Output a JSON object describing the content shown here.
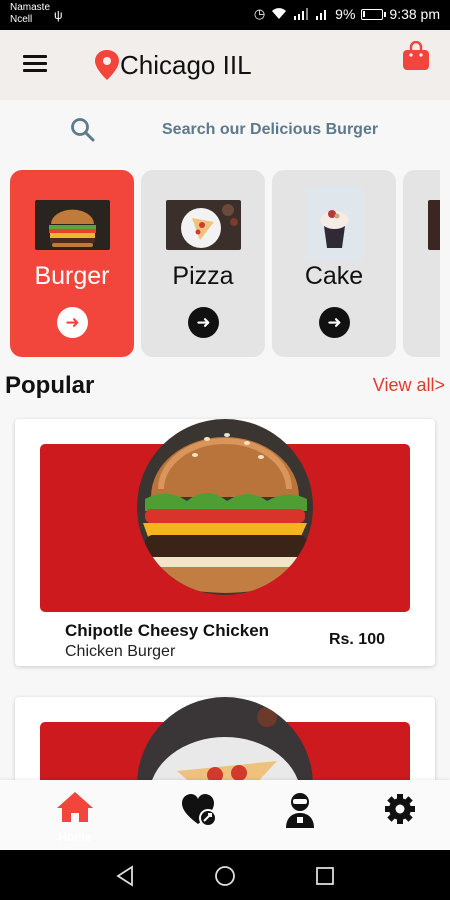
{
  "status_bar": {
    "carrier_line1": "Namaste",
    "carrier_line2": "Ncell",
    "battery": "9%",
    "battery_level": 0.09,
    "time": "9:38 pm"
  },
  "header": {
    "location": "Chicago IIL",
    "icons": [
      "menu-icon",
      "location-pin-icon",
      "shopping-bag-icon"
    ]
  },
  "search": {
    "placeholder": "Search our Delicious Burger"
  },
  "categories": [
    {
      "label": "Burger",
      "selected": true
    },
    {
      "label": "Pizza",
      "selected": false
    },
    {
      "label": "Cake",
      "selected": false
    },
    {
      "label": "",
      "selected": false
    }
  ],
  "popular": {
    "title": "Popular",
    "view_all": "View all>",
    "items": [
      {
        "name": "Chipotle Cheesy Chicken",
        "category": "Chicken Burger",
        "price": "Rs. 100"
      },
      {
        "name": "",
        "category": "",
        "price": ""
      }
    ]
  },
  "bottom_nav": {
    "items": [
      {
        "label": "Home",
        "icon": "home-icon"
      },
      {
        "label": "",
        "icon": "favorite-icon"
      },
      {
        "label": "",
        "icon": "profile-icon"
      },
      {
        "label": "",
        "icon": "settings-icon"
      }
    ]
  },
  "colors": {
    "accent": "#f2463c",
    "card_banner": "#cd1a1e",
    "link": "#e5392f",
    "search_text": "#5d7a8c",
    "header_bg": "#f2eeec"
  }
}
